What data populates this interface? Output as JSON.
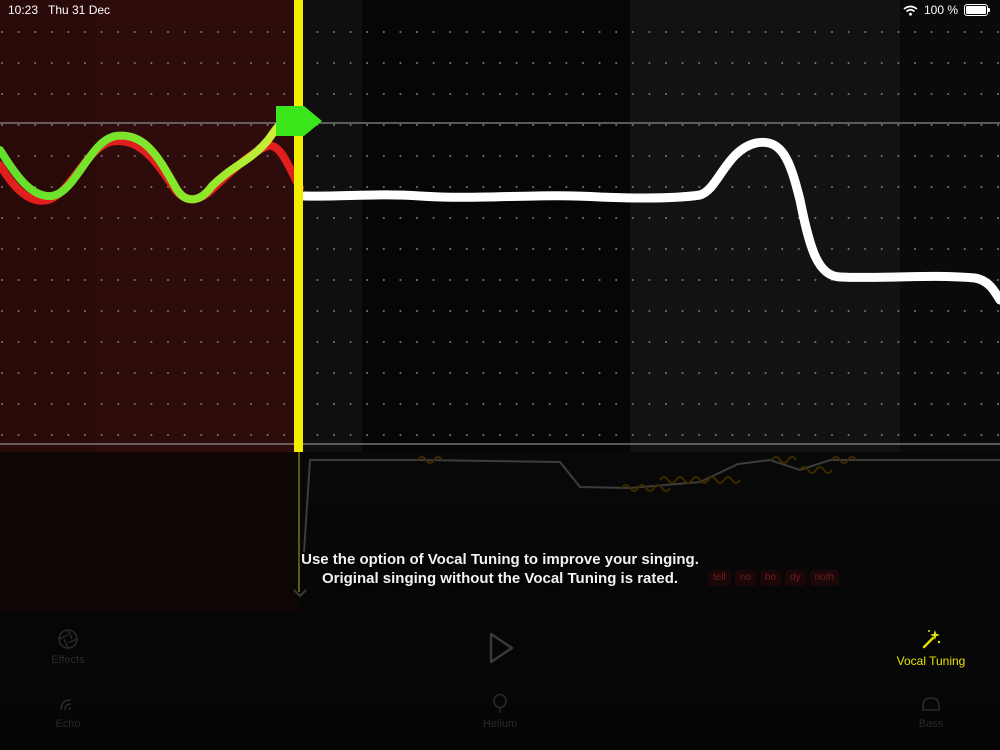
{
  "status_bar": {
    "time": "10:23",
    "date": "Thu 31 Dec",
    "battery": "100 %"
  },
  "pitch_view": {
    "colors": {
      "sung_green": "#6ee62a",
      "sung_red": "#e01e1e",
      "guide_white": "#ffffff",
      "playhead": "#f2ee00",
      "marker": "#3be61a"
    }
  },
  "lyrics": {
    "syllables": [
      "tell",
      "no",
      "bo",
      "dy",
      "noth"
    ]
  },
  "tip": {
    "line1": "Use the option of Vocal Tuning to improve your singing.",
    "line2": "Original singing without the Vocal Tuning is rated."
  },
  "toolbar": {
    "effects": "Effects",
    "vocal_tuning": "Vocal Tuning",
    "echo": "Echo",
    "helium": "Helium",
    "bass": "Bass"
  }
}
